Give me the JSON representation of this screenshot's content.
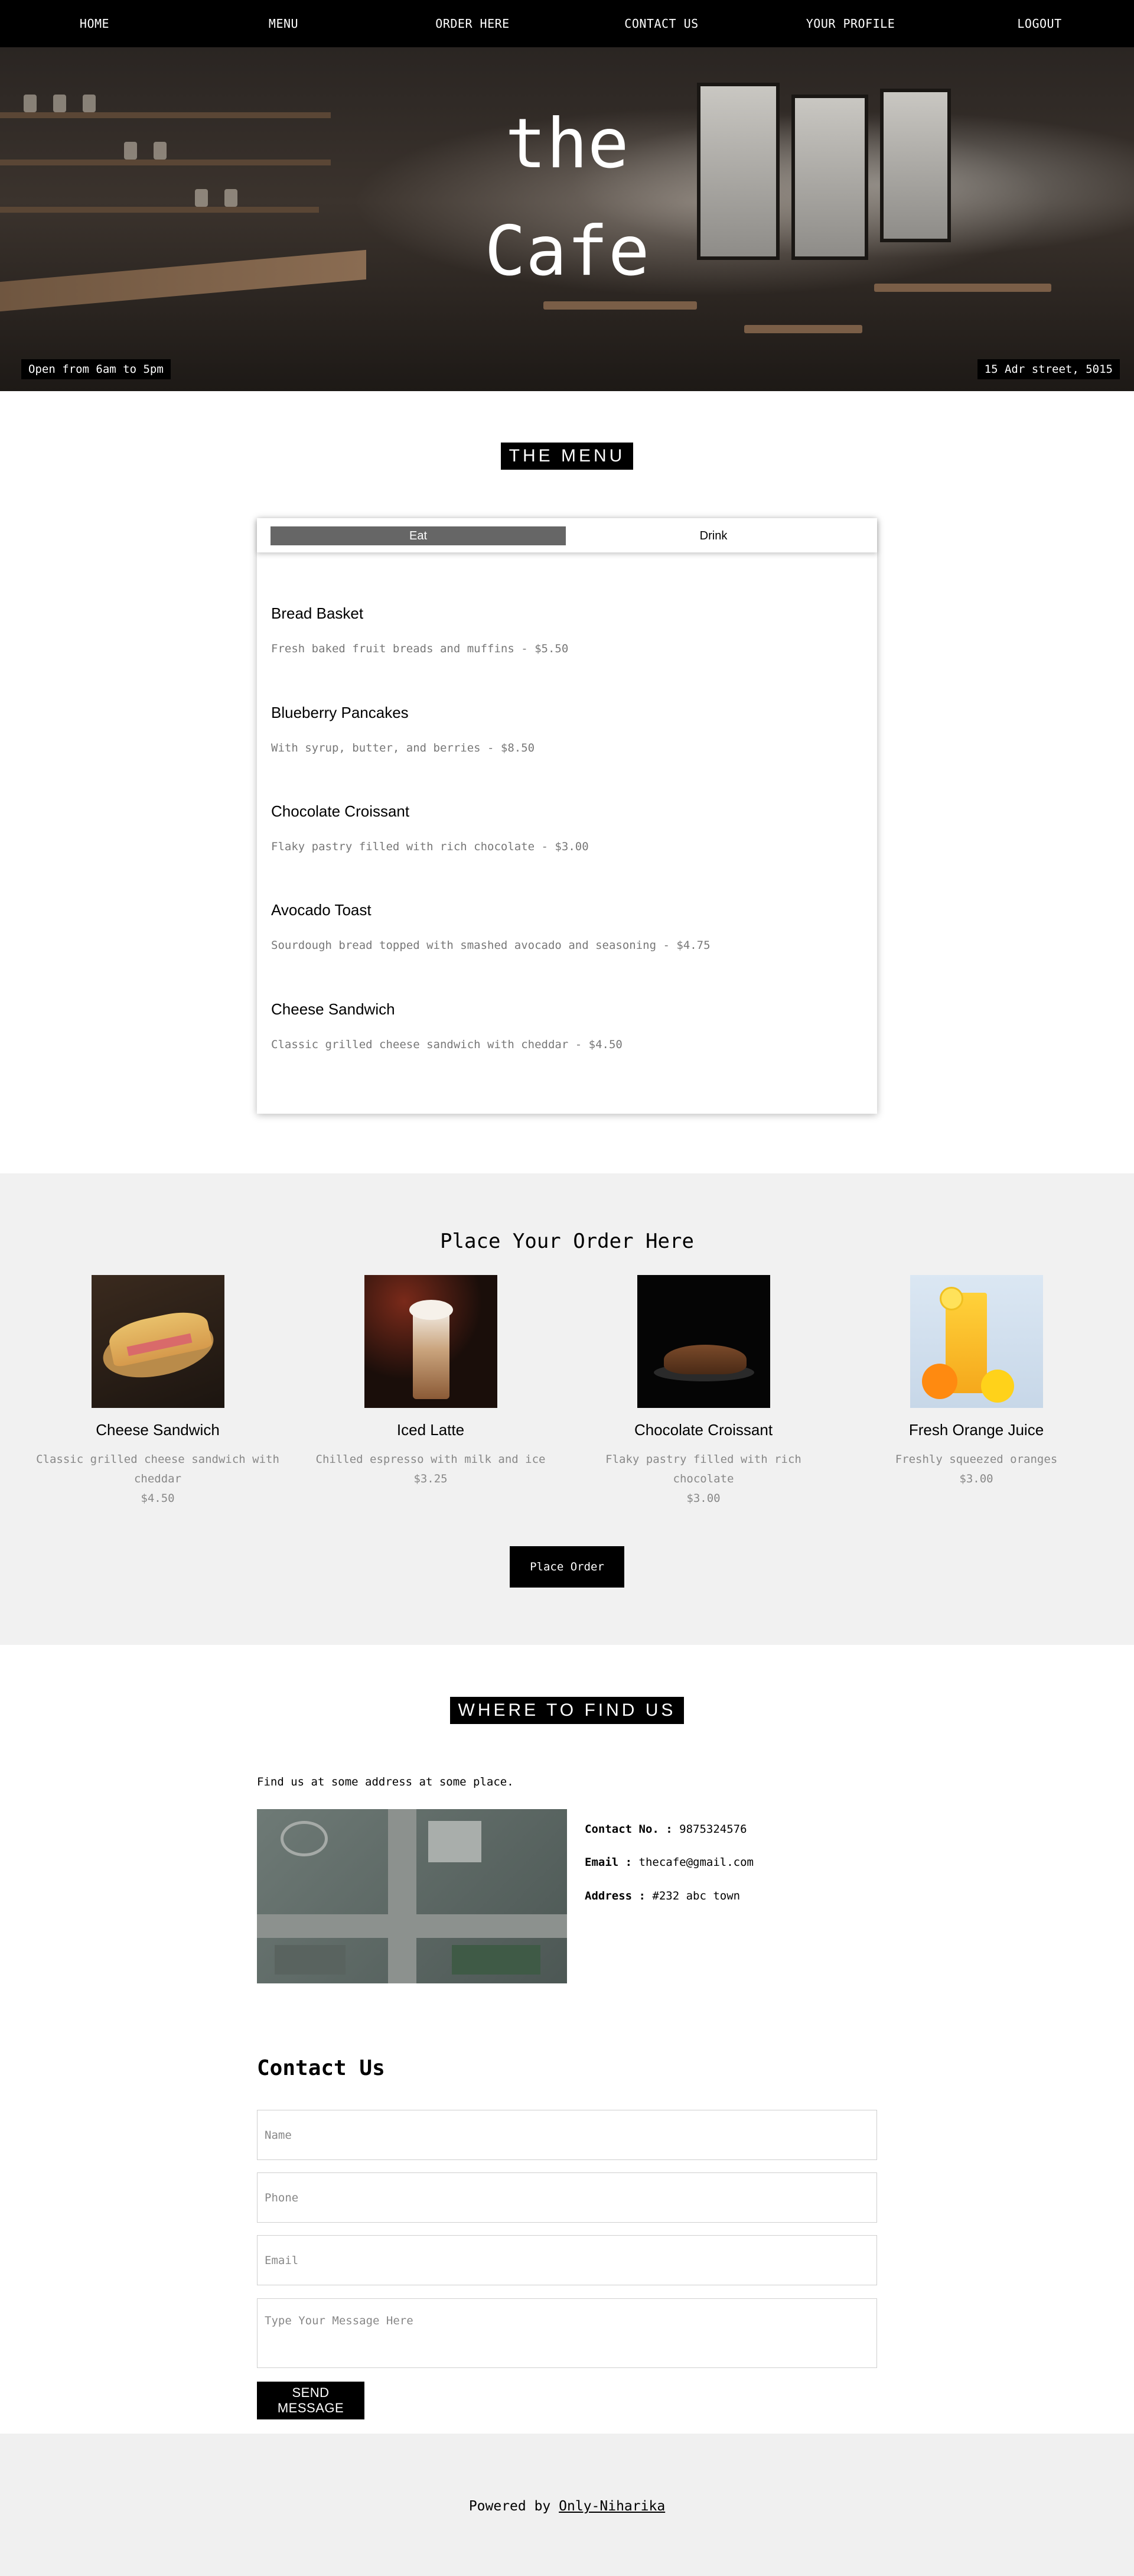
{
  "nav": {
    "items": [
      "HOME",
      "MENU",
      "ORDER HERE",
      "CONTACT US",
      "YOUR PROFILE",
      "LOGOUT"
    ]
  },
  "hero": {
    "title_line1": "the",
    "title_line2": "Cafe",
    "hours": "Open from 6am to 5pm",
    "address": "15 Adr street, 5015"
  },
  "menu": {
    "heading": "THE MENU",
    "tabs": [
      "Eat",
      "Drink"
    ],
    "active_tab": "Eat",
    "items": [
      {
        "name": "Bread Basket",
        "desc": "Fresh baked fruit breads and muffins - $5.50"
      },
      {
        "name": "Blueberry Pancakes",
        "desc": "With syrup, butter, and berries - $8.50"
      },
      {
        "name": "Chocolate Croissant",
        "desc": "Flaky pastry filled with rich chocolate - $3.00"
      },
      {
        "name": "Avocado Toast",
        "desc": "Sourdough bread topped with smashed avocado and seasoning - $4.75"
      },
      {
        "name": "Cheese Sandwich",
        "desc": "Classic grilled cheese sandwich with cheddar - $4.50"
      }
    ]
  },
  "order": {
    "title": "Place Your Order Here",
    "products": [
      {
        "name": "Cheese Sandwich",
        "desc_line1": "Classic grilled cheese sandwich with",
        "desc_line2": "cheddar",
        "price": "$4.50"
      },
      {
        "name": "Iced Latte",
        "desc_line1": "Chilled espresso with milk and ice",
        "desc_line2": "",
        "price": "$3.25"
      },
      {
        "name": "Chocolate Croissant",
        "desc_line1": "Flaky pastry filled with rich",
        "desc_line2": "chocolate",
        "price": "$3.00"
      },
      {
        "name": "Fresh Orange Juice",
        "desc_line1": "Freshly squeezed oranges",
        "desc_line2": "",
        "price": "$3.00"
      }
    ],
    "button": "Place Order"
  },
  "find": {
    "heading": "WHERE TO FIND US",
    "text": "Find us at some address at some place.",
    "contact_label": "Contact No. :",
    "contact_value": "9875324576",
    "email_label": "Email :",
    "email_value": "thecafe@gmail.com",
    "address_label": "Address :",
    "address_value": "#232 abc town"
  },
  "contact": {
    "title": "Contact Us",
    "name_placeholder": "Name",
    "phone_placeholder": "Phone",
    "email_placeholder": "Email",
    "message_placeholder": "Type Your Message Here",
    "send_button": "SEND MESSAGE"
  },
  "footer": {
    "powered_by": "Powered by",
    "link": "Only-Niharika"
  }
}
